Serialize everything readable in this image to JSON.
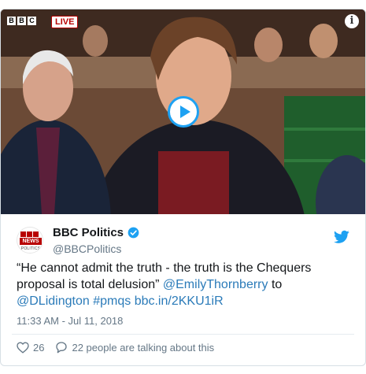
{
  "media": {
    "logo_letters": [
      "B",
      "B",
      "C"
    ],
    "live_badge": "LIVE",
    "info_icon_glyph": "i",
    "icons": [
      "bbc-logo",
      "info-icon",
      "play-icon"
    ]
  },
  "account": {
    "display_name": "BBC Politics",
    "handle": "@BBCPolitics",
    "avatar": {
      "news": "NEWS",
      "politics": "POLITICS"
    },
    "verified": true
  },
  "tweet": {
    "text_before": "“He cannot admit the truth - the truth is the Chequers proposal is total delusion” ",
    "mention_1": "@EmilyThornberry",
    "text_to": " to ",
    "mention_2": "@DLidington",
    "hashtag": "#pmqs",
    "link": "bbc.in/2KKU1iR",
    "timestamp": "11:33 AM - Jul 11, 2018"
  },
  "actions": {
    "likes": "26",
    "conversation": "22 people are talking about this"
  },
  "colors": {
    "link": "#2b7bb9",
    "twitter_blue": "#1da1f2",
    "bbc_red": "#b80000",
    "muted": "#657786"
  }
}
